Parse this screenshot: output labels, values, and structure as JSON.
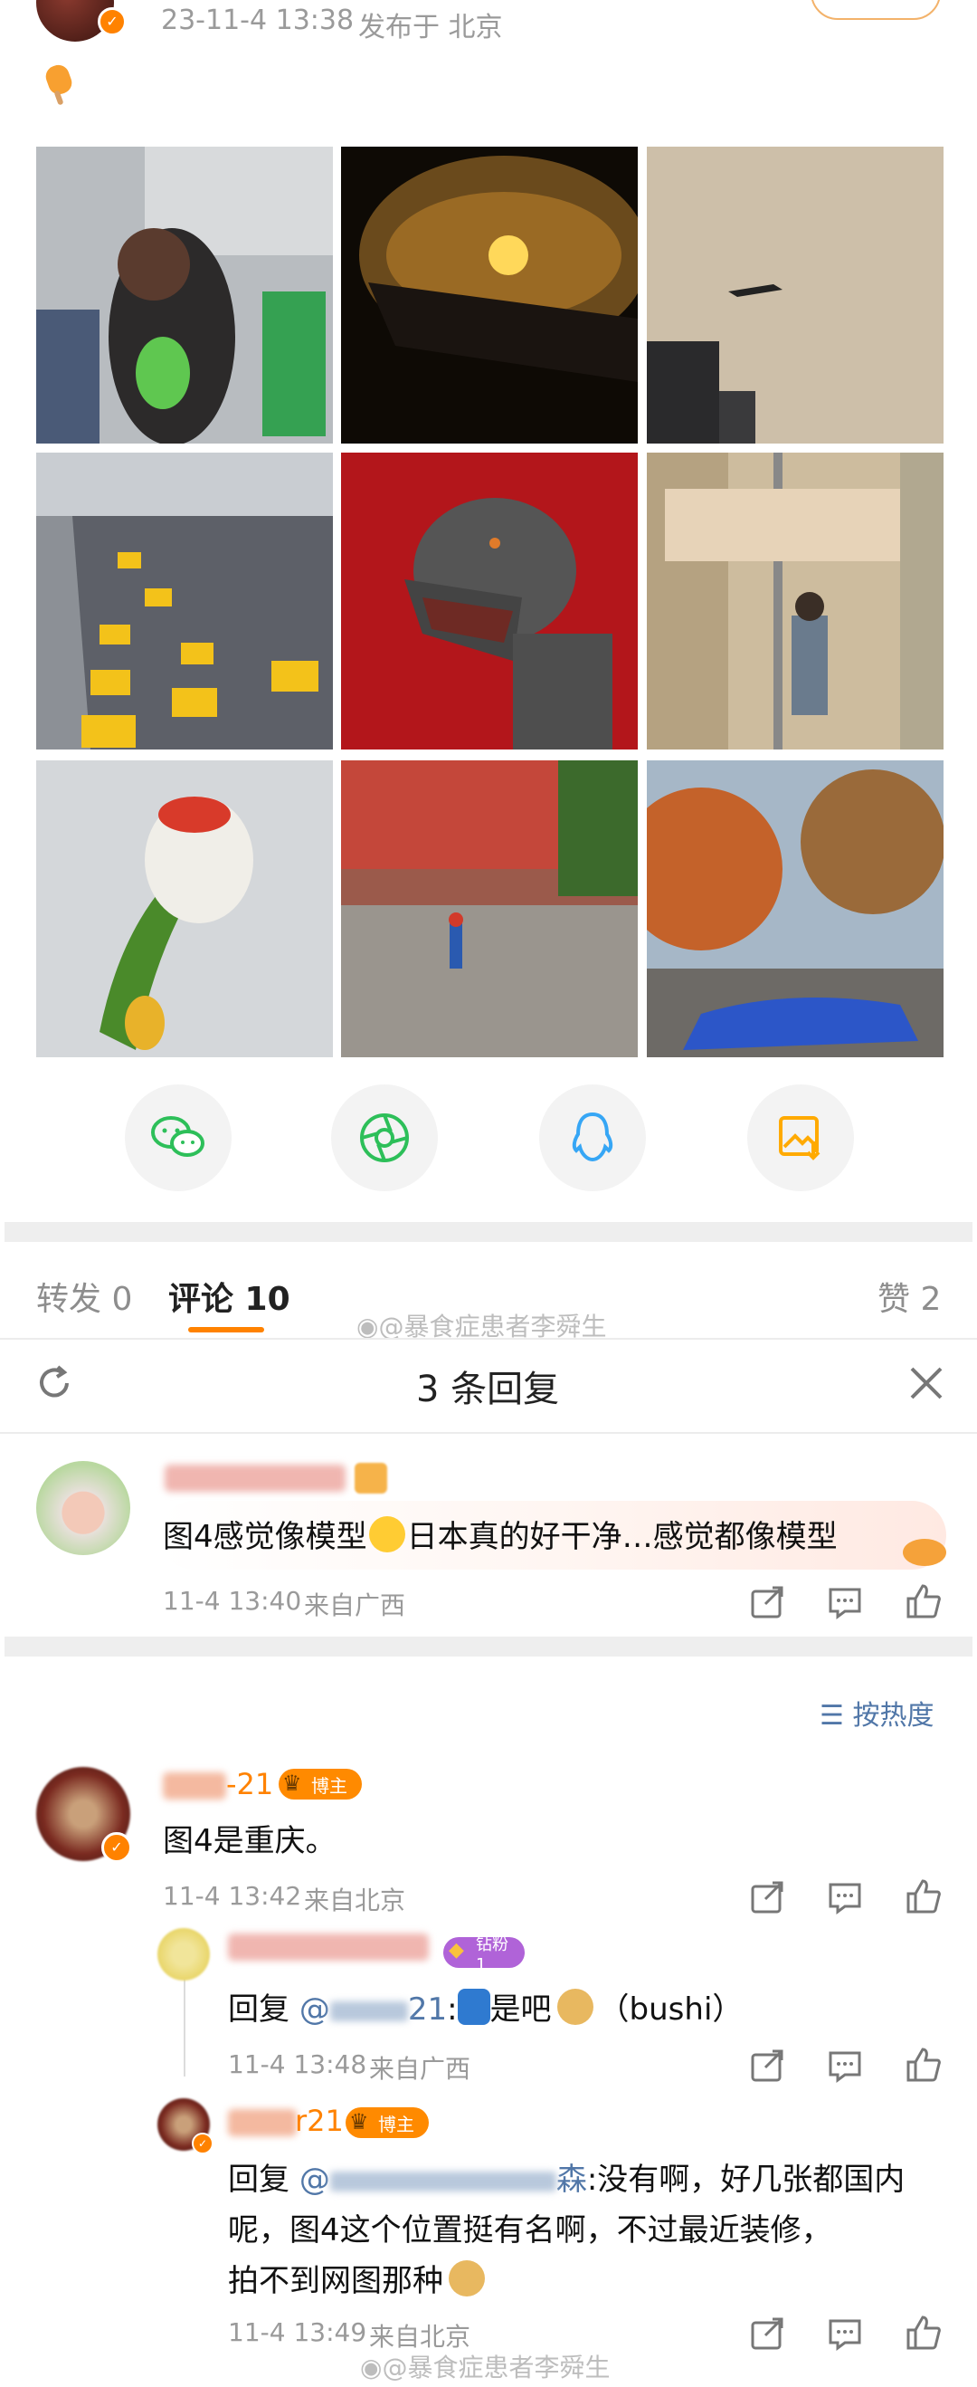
{
  "post": {
    "timestamp": "23-11-4 13:38",
    "location": "发布于 北京"
  },
  "share_buttons": [
    "wechat",
    "moments",
    "qq",
    "save-image"
  ],
  "tabs": {
    "repost": "转发 0",
    "comment": "评论 10",
    "like": "赞 2"
  },
  "watermark": "@暴食症患者李舜生",
  "reply_panel": {
    "title": "3 条回复",
    "root_comment": {
      "text_a": "图4感觉像模型",
      "text_b": "日本真的好干净…感觉都像模型",
      "time": "11-4 13:40",
      "source": "来自广西"
    },
    "sort_label": "按热度",
    "replies": [
      {
        "name_suffix": "-21",
        "badge": "博主",
        "text": "图4是重庆。",
        "time": "11-4 13:42",
        "source": "来自北京"
      },
      {
        "badge": "钻粉1",
        "reply_prefix": "回复",
        "mention": "@",
        "mention_tail": "21",
        "text_a": ":",
        "text_b": "是吧",
        "text_c": "（bushi）",
        "time": "11-4 13:48",
        "source": "来自广西"
      },
      {
        "name_suffix": "r21",
        "badge": "博主",
        "reply_prefix": "回复",
        "mention": "@",
        "mention_tail": "森",
        "line1_rest": ":没有啊，好几张都国内",
        "line2": "呢，图4这个位置挺有名啊，不过最近装修，",
        "line3": "拍不到网图那种",
        "time": "11-4 13:49",
        "source": "来自北京"
      }
    ]
  },
  "colors": {
    "accent": "#ff8200",
    "link": "#5177a8",
    "wechat": "#2dbf59",
    "qq": "#36a6f5",
    "save": "#ffaa00"
  }
}
